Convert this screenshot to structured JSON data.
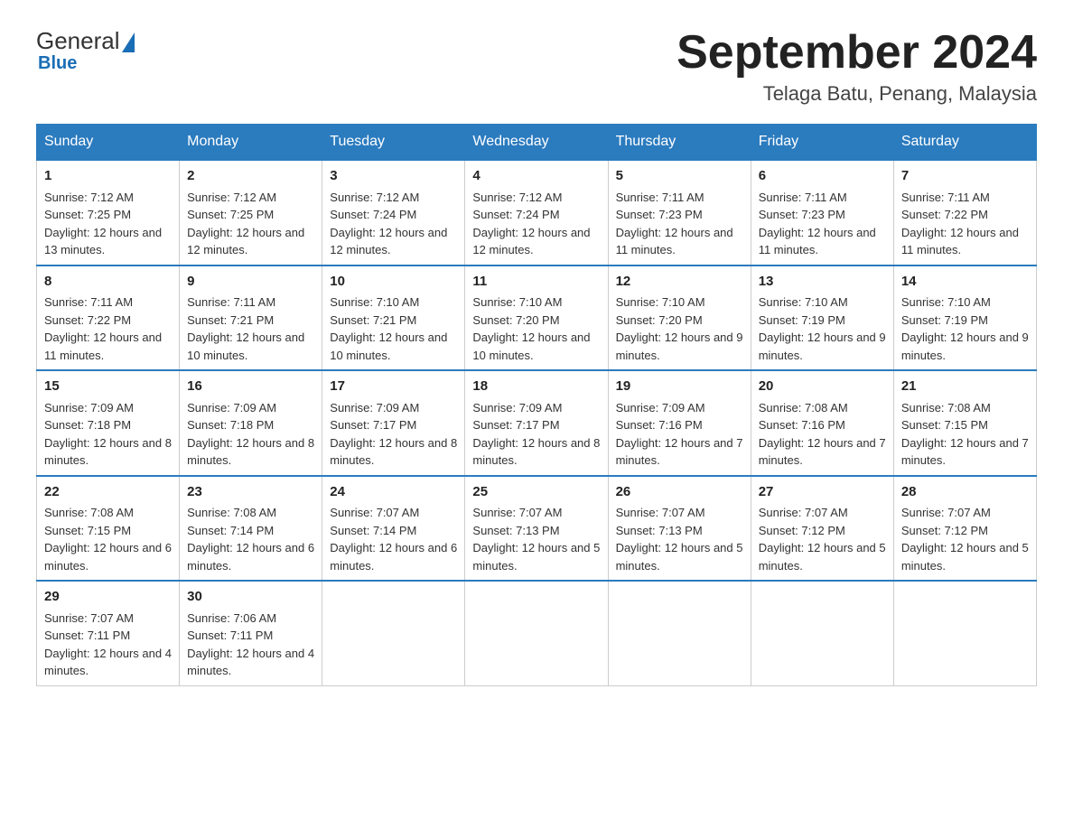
{
  "header": {
    "logo_general": "General",
    "logo_blue": "Blue",
    "month_title": "September 2024",
    "location": "Telaga Batu, Penang, Malaysia"
  },
  "calendar": {
    "days_of_week": [
      "Sunday",
      "Monday",
      "Tuesday",
      "Wednesday",
      "Thursday",
      "Friday",
      "Saturday"
    ],
    "weeks": [
      [
        {
          "date": "1",
          "sunrise": "7:12 AM",
          "sunset": "7:25 PM",
          "daylight": "12 hours and 13 minutes."
        },
        {
          "date": "2",
          "sunrise": "7:12 AM",
          "sunset": "7:25 PM",
          "daylight": "12 hours and 12 minutes."
        },
        {
          "date": "3",
          "sunrise": "7:12 AM",
          "sunset": "7:24 PM",
          "daylight": "12 hours and 12 minutes."
        },
        {
          "date": "4",
          "sunrise": "7:12 AM",
          "sunset": "7:24 PM",
          "daylight": "12 hours and 12 minutes."
        },
        {
          "date": "5",
          "sunrise": "7:11 AM",
          "sunset": "7:23 PM",
          "daylight": "12 hours and 11 minutes."
        },
        {
          "date": "6",
          "sunrise": "7:11 AM",
          "sunset": "7:23 PM",
          "daylight": "12 hours and 11 minutes."
        },
        {
          "date": "7",
          "sunrise": "7:11 AM",
          "sunset": "7:22 PM",
          "daylight": "12 hours and 11 minutes."
        }
      ],
      [
        {
          "date": "8",
          "sunrise": "7:11 AM",
          "sunset": "7:22 PM",
          "daylight": "12 hours and 11 minutes."
        },
        {
          "date": "9",
          "sunrise": "7:11 AM",
          "sunset": "7:21 PM",
          "daylight": "12 hours and 10 minutes."
        },
        {
          "date": "10",
          "sunrise": "7:10 AM",
          "sunset": "7:21 PM",
          "daylight": "12 hours and 10 minutes."
        },
        {
          "date": "11",
          "sunrise": "7:10 AM",
          "sunset": "7:20 PM",
          "daylight": "12 hours and 10 minutes."
        },
        {
          "date": "12",
          "sunrise": "7:10 AM",
          "sunset": "7:20 PM",
          "daylight": "12 hours and 9 minutes."
        },
        {
          "date": "13",
          "sunrise": "7:10 AM",
          "sunset": "7:19 PM",
          "daylight": "12 hours and 9 minutes."
        },
        {
          "date": "14",
          "sunrise": "7:10 AM",
          "sunset": "7:19 PM",
          "daylight": "12 hours and 9 minutes."
        }
      ],
      [
        {
          "date": "15",
          "sunrise": "7:09 AM",
          "sunset": "7:18 PM",
          "daylight": "12 hours and 8 minutes."
        },
        {
          "date": "16",
          "sunrise": "7:09 AM",
          "sunset": "7:18 PM",
          "daylight": "12 hours and 8 minutes."
        },
        {
          "date": "17",
          "sunrise": "7:09 AM",
          "sunset": "7:17 PM",
          "daylight": "12 hours and 8 minutes."
        },
        {
          "date": "18",
          "sunrise": "7:09 AM",
          "sunset": "7:17 PM",
          "daylight": "12 hours and 8 minutes."
        },
        {
          "date": "19",
          "sunrise": "7:09 AM",
          "sunset": "7:16 PM",
          "daylight": "12 hours and 7 minutes."
        },
        {
          "date": "20",
          "sunrise": "7:08 AM",
          "sunset": "7:16 PM",
          "daylight": "12 hours and 7 minutes."
        },
        {
          "date": "21",
          "sunrise": "7:08 AM",
          "sunset": "7:15 PM",
          "daylight": "12 hours and 7 minutes."
        }
      ],
      [
        {
          "date": "22",
          "sunrise": "7:08 AM",
          "sunset": "7:15 PM",
          "daylight": "12 hours and 6 minutes."
        },
        {
          "date": "23",
          "sunrise": "7:08 AM",
          "sunset": "7:14 PM",
          "daylight": "12 hours and 6 minutes."
        },
        {
          "date": "24",
          "sunrise": "7:07 AM",
          "sunset": "7:14 PM",
          "daylight": "12 hours and 6 minutes."
        },
        {
          "date": "25",
          "sunrise": "7:07 AM",
          "sunset": "7:13 PM",
          "daylight": "12 hours and 5 minutes."
        },
        {
          "date": "26",
          "sunrise": "7:07 AM",
          "sunset": "7:13 PM",
          "daylight": "12 hours and 5 minutes."
        },
        {
          "date": "27",
          "sunrise": "7:07 AM",
          "sunset": "7:12 PM",
          "daylight": "12 hours and 5 minutes."
        },
        {
          "date": "28",
          "sunrise": "7:07 AM",
          "sunset": "7:12 PM",
          "daylight": "12 hours and 5 minutes."
        }
      ],
      [
        {
          "date": "29",
          "sunrise": "7:07 AM",
          "sunset": "7:11 PM",
          "daylight": "12 hours and 4 minutes."
        },
        {
          "date": "30",
          "sunrise": "7:06 AM",
          "sunset": "7:11 PM",
          "daylight": "12 hours and 4 minutes."
        },
        null,
        null,
        null,
        null,
        null
      ]
    ]
  }
}
